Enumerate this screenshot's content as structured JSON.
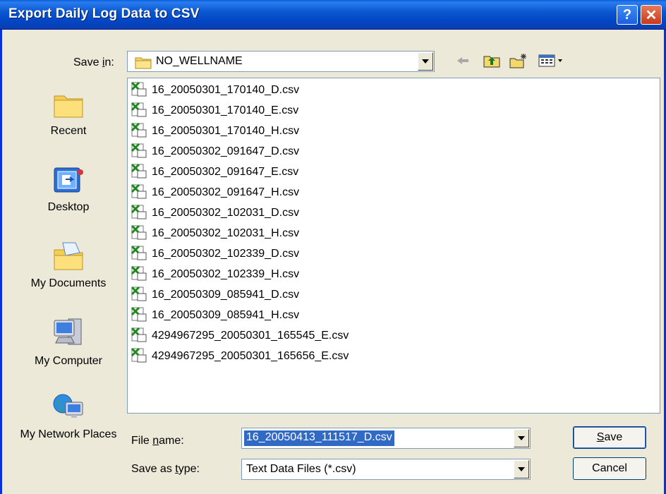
{
  "window": {
    "title": "Export Daily Log Data to CSV",
    "help_symbol": "?",
    "close_symbol": "✕"
  },
  "save_in": {
    "label_before": "Save ",
    "label_underlined": "i",
    "label_after": "n:",
    "folder": "NO_WELLNAME"
  },
  "toolbar": {
    "icons": [
      "back-arrow-icon",
      "up-folder-icon",
      "new-folder-icon",
      "view-menu-icon"
    ]
  },
  "places": [
    {
      "label": "Recent",
      "icon": "recent-folder-icon"
    },
    {
      "label": "Desktop",
      "icon": "desktop-icon"
    },
    {
      "label": "My Documents",
      "icon": "my-documents-icon"
    },
    {
      "label": "My Computer",
      "icon": "my-computer-icon"
    },
    {
      "label": "My Network Places",
      "icon": "network-places-icon"
    }
  ],
  "files": [
    "16_20050301_170140_D.csv",
    "16_20050301_170140_E.csv",
    "16_20050301_170140_H.csv",
    "16_20050302_091647_D.csv",
    "16_20050302_091647_E.csv",
    "16_20050302_091647_H.csv",
    "16_20050302_102031_D.csv",
    "16_20050302_102031_H.csv",
    "16_20050302_102339_D.csv",
    "16_20050302_102339_H.csv",
    "16_20050309_085941_D.csv",
    "16_20050309_085941_H.csv",
    "4294967295_20050301_165545_E.csv",
    "4294967295_20050301_165656_E.csv"
  ],
  "file_name": {
    "label_before": "File ",
    "label_underlined": "n",
    "label_after": "ame:",
    "value": "16_20050413_111517_D.csv"
  },
  "save_as_type": {
    "label_before": "Save as ",
    "label_underlined": "t",
    "label_after": "ype:",
    "value": "Text Data Files (*.csv)"
  },
  "buttons": {
    "save_underlined": "S",
    "save_rest": "ave",
    "cancel": "Cancel"
  },
  "colors": {
    "title_bar": "#0247c6",
    "selection": "#316ac5",
    "dialog_bg": "#ECE9D8"
  }
}
